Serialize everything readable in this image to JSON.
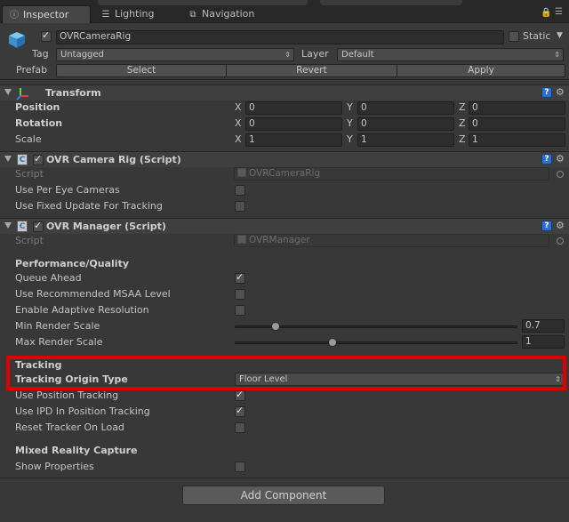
{
  "tabs": [
    {
      "label": "Inspector",
      "icon": "info-icon",
      "active": true
    },
    {
      "label": "Lighting",
      "icon": "lighting-icon",
      "active": false
    },
    {
      "label": "Navigation",
      "icon": "navigation-icon",
      "active": false
    }
  ],
  "header": {
    "object_name": "OVRCameraRig",
    "static_label": "Static",
    "tag_label": "Tag",
    "tag_value": "Untagged",
    "layer_label": "Layer",
    "layer_value": "Default",
    "prefab_label": "Prefab",
    "select_label": "Select",
    "revert_label": "Revert",
    "apply_label": "Apply"
  },
  "transform": {
    "title": "Transform",
    "rows": [
      {
        "label": "Position",
        "x": "0",
        "y": "0",
        "z": "0"
      },
      {
        "label": "Rotation",
        "x": "0",
        "y": "0",
        "z": "0"
      },
      {
        "label": "Scale",
        "x": "1",
        "y": "1",
        "z": "1"
      }
    ],
    "axis": {
      "x": "X",
      "y": "Y",
      "z": "Z"
    }
  },
  "camera_rig": {
    "title": "OVR Camera Rig (Script)",
    "script_label": "Script",
    "script_value": "OVRCameraRig",
    "per_eye_label": "Use Per Eye Cameras",
    "fixed_update_label": "Use Fixed Update For Tracking"
  },
  "manager": {
    "title": "OVR Manager (Script)",
    "script_label": "Script",
    "script_value": "OVRManager",
    "perf_section": "Performance/Quality",
    "queue_ahead": "Queue Ahead",
    "msaa": "Use Recommended MSAA Level",
    "adaptive": "Enable Adaptive Resolution",
    "min_scale_label": "Min Render Scale",
    "min_scale_value": "0.7",
    "max_scale_label": "Max Render Scale",
    "max_scale_value": "1",
    "tracking_section": "Tracking",
    "origin_label": "Tracking Origin Type",
    "origin_value": "Floor Level",
    "pos_tracking": "Use Position Tracking",
    "ipd_tracking": "Use IPD In Position Tracking",
    "reset_tracker": "Reset Tracker On Load",
    "mrc_section": "Mixed Reality Capture",
    "show_props": "Show Properties"
  },
  "add_component_label": "Add Component",
  "slider_values": {
    "min_scale": 0.7,
    "max_scale": 1,
    "range": [
      0.5,
      2.0
    ]
  }
}
